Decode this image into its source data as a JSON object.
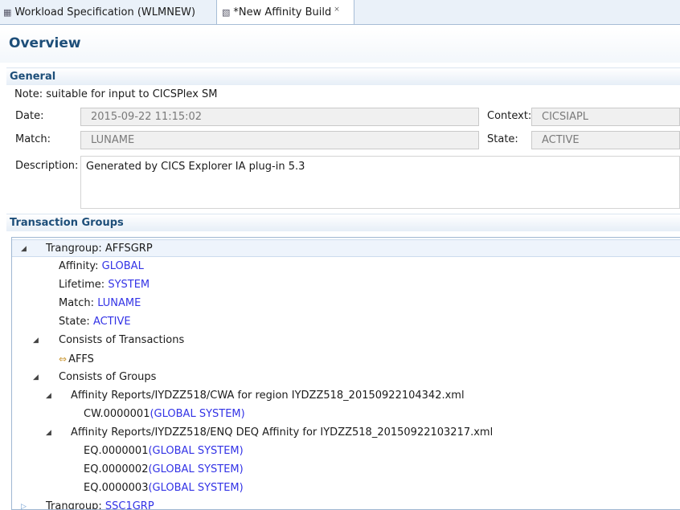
{
  "tabs": [
    {
      "icon": "workload-icon",
      "label": "Workload Specification (WLMNEW)"
    },
    {
      "icon": "affinity-icon",
      "label": "*New Affinity Build",
      "close": "⨯"
    }
  ],
  "overview_title": "Overview",
  "general": {
    "heading": "General",
    "note": "Note: suitable for input to CICSPlex SM",
    "date_label": "Date:",
    "date_value": "2015-09-22 11:15:02",
    "context_label": "Context:",
    "context_value": "CICSIAPL",
    "match_label": "Match:",
    "match_value": "LUNAME",
    "state_label": "State:",
    "state_value": "ACTIVE",
    "description_label": "Description:",
    "description_value": "Generated by CICS Explorer IA plug-in 5.3"
  },
  "transaction_groups": {
    "heading": "Transaction Groups",
    "group1": {
      "prefix": "Trangroup: ",
      "name": "AFFSGRP",
      "affinity_label": "Affinity: ",
      "affinity_value": "GLOBAL",
      "lifetime_label": "Lifetime: ",
      "lifetime_value": "SYSTEM",
      "match_label": "Match: ",
      "match_value": "LUNAME",
      "state_label": "State: ",
      "state_value": "ACTIVE",
      "transactions_label": "Consists of Transactions",
      "transaction": "AFFS",
      "groups_label": "Consists of Groups",
      "report1": "Affinity Reports/IYDZZ518/CWA for region IYDZZ518_20150922104342.xml",
      "report1_items": [
        {
          "id": "CW.0000001",
          "detail": "(GLOBAL SYSTEM)"
        }
      ],
      "report2": "Affinity Reports/IYDZZ518/ENQ DEQ Affinity for IYDZZ518_20150922103217.xml",
      "report2_items": [
        {
          "id": "EQ.0000001",
          "detail": "(GLOBAL SYSTEM)"
        },
        {
          "id": "EQ.0000002",
          "detail": "(GLOBAL SYSTEM)"
        },
        {
          "id": "EQ.0000003",
          "detail": "(GLOBAL SYSTEM)"
        }
      ]
    },
    "group2": {
      "prefix": "Trangroup: ",
      "name": "SSC1GRP"
    }
  },
  "colors": {
    "heading": "#1d4e79",
    "link": "#3333e6",
    "selection": "#eef4fc"
  }
}
